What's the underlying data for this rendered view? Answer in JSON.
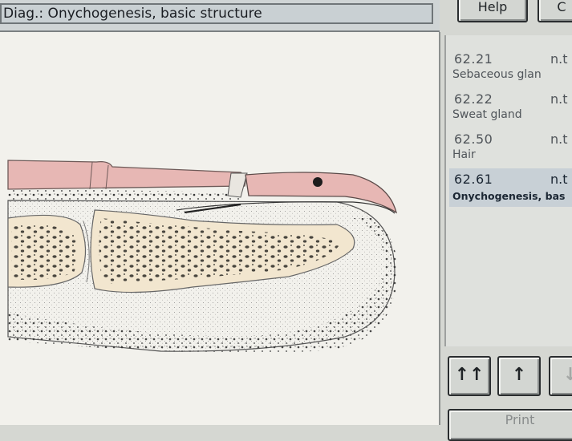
{
  "window": {
    "title": "Diag.: Onychogenesis, basic structure"
  },
  "toolbar": {
    "help_label": "Help",
    "next_label": "C"
  },
  "list": {
    "items": [
      {
        "code": "62.21",
        "status": "n.t",
        "name": "Sebaceous glan",
        "selected": false
      },
      {
        "code": "62.22",
        "status": "n.t",
        "name": "Sweat gland",
        "selected": false
      },
      {
        "code": "62.50",
        "status": "n.t",
        "name": "Hair",
        "selected": false
      },
      {
        "code": "62.61",
        "status": "n.t",
        "name": "Onychogenesis, bas",
        "selected": true
      }
    ]
  },
  "nav": {
    "first_icon": "double-up-arrow-icon",
    "up_icon": "up-arrow-icon",
    "down_icon": "down-arrow-icon",
    "print_label": "Print"
  },
  "colors": {
    "panel_bg": "#f2f1ec",
    "skin_pink": "#e7b7b4",
    "bone_fill": "#f2e6cf",
    "selected_row": "#c8d0d6"
  }
}
